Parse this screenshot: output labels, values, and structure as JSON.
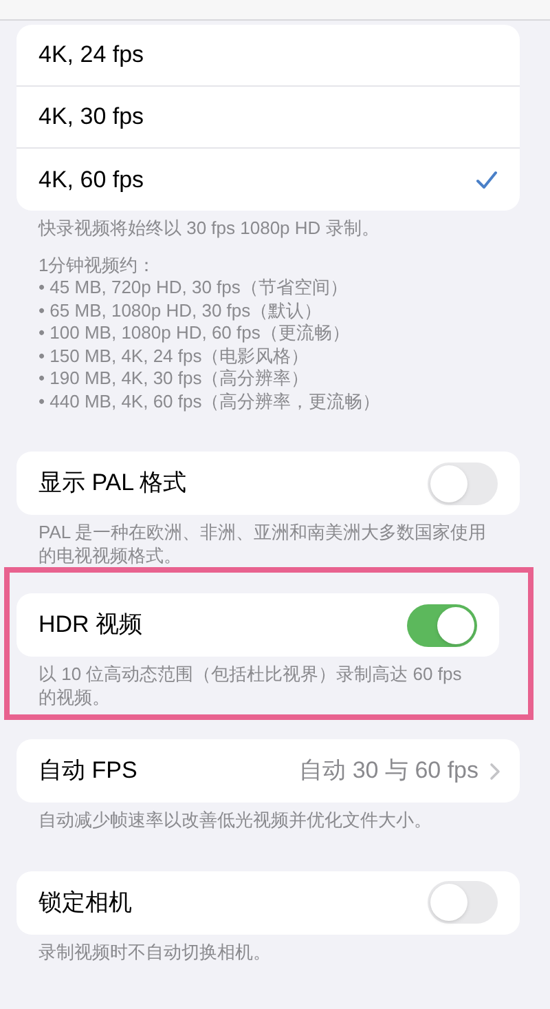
{
  "sections": [
    {
      "kind": "options",
      "highlighted": false,
      "rows": [
        {
          "label": "4K, 24 fps",
          "selected": false
        },
        {
          "label": "4K, 30 fps",
          "selected": false
        },
        {
          "label": "4K, 60 fps",
          "selected": true
        }
      ],
      "footer": [
        {
          "lines": [
            "快录视频将始终以 30 fps 1080p HD 录制。"
          ]
        },
        {
          "lines": [
            "1分钟视频约：",
            "• 45 MB, 720p HD, 30 fps（节省空间）",
            "• 65 MB, 1080p HD, 30 fps（默认）",
            "• 100 MB, 1080p HD, 60 fps（更流畅）",
            "• 150 MB, 4K, 24 fps（电影风格）",
            "• 190 MB, 4K, 30 fps（高分辨率）",
            "• 440 MB, 4K, 60 fps（高分辨率，更流畅）"
          ]
        }
      ]
    },
    {
      "kind": "toggle",
      "highlighted": false,
      "label": "显示 PAL 格式",
      "on": false,
      "footer": [
        {
          "lines": [
            "PAL 是一种在欧洲、非洲、亚洲和南美洲大多数国家使用的电视视频格式。"
          ]
        }
      ]
    },
    {
      "kind": "toggle",
      "highlighted": true,
      "label": "HDR 视频",
      "on": true,
      "footer": [
        {
          "lines": [
            "以 10 位高动态范围（包括杜比视界）录制高达 60 fps 的视频。"
          ]
        }
      ]
    },
    {
      "kind": "link",
      "highlighted": false,
      "label": "自动 FPS",
      "value": "自动 30 与 60 fps",
      "footer": [
        {
          "lines": [
            "自动减少帧速率以改善低光视频并优化文件大小。"
          ]
        }
      ]
    },
    {
      "kind": "toggle",
      "highlighted": false,
      "label": "锁定相机",
      "on": false,
      "footer": [
        {
          "lines": [
            "录制视频时不自动切换相机。"
          ]
        }
      ]
    }
  ]
}
